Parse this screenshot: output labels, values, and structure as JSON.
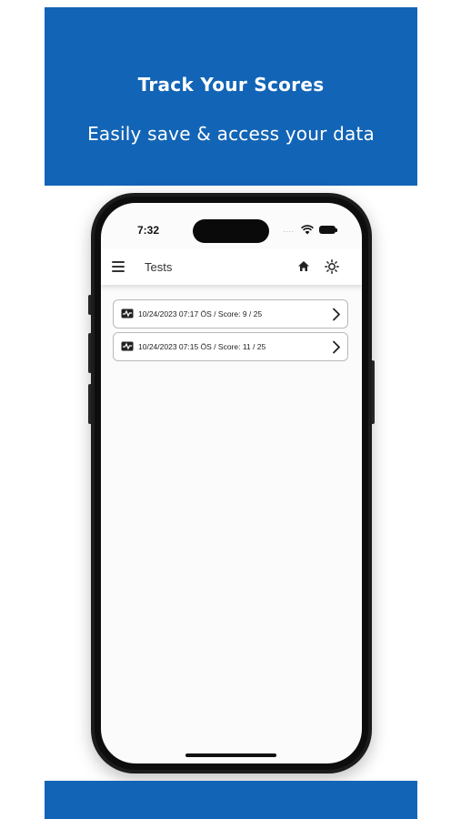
{
  "banner": {
    "title": "Track Your Scores",
    "subtitle": "Easily save & access your data",
    "color": "#1264b6"
  },
  "status_bar": {
    "time": "7:32",
    "icons": [
      "signal-dots-icon",
      "wifi-icon",
      "battery-icon"
    ]
  },
  "app_header": {
    "title": "Tests",
    "icons": [
      "menu-icon",
      "home-icon",
      "sun-icon"
    ]
  },
  "tests": [
    {
      "label": "10/24/2023 07:17 ÖS  / Score: 9 / 25",
      "icon": "test-result-icon"
    },
    {
      "label": "10/24/2023 07:15 ÖS  / Score: 11 / 25",
      "icon": "test-result-icon"
    }
  ]
}
